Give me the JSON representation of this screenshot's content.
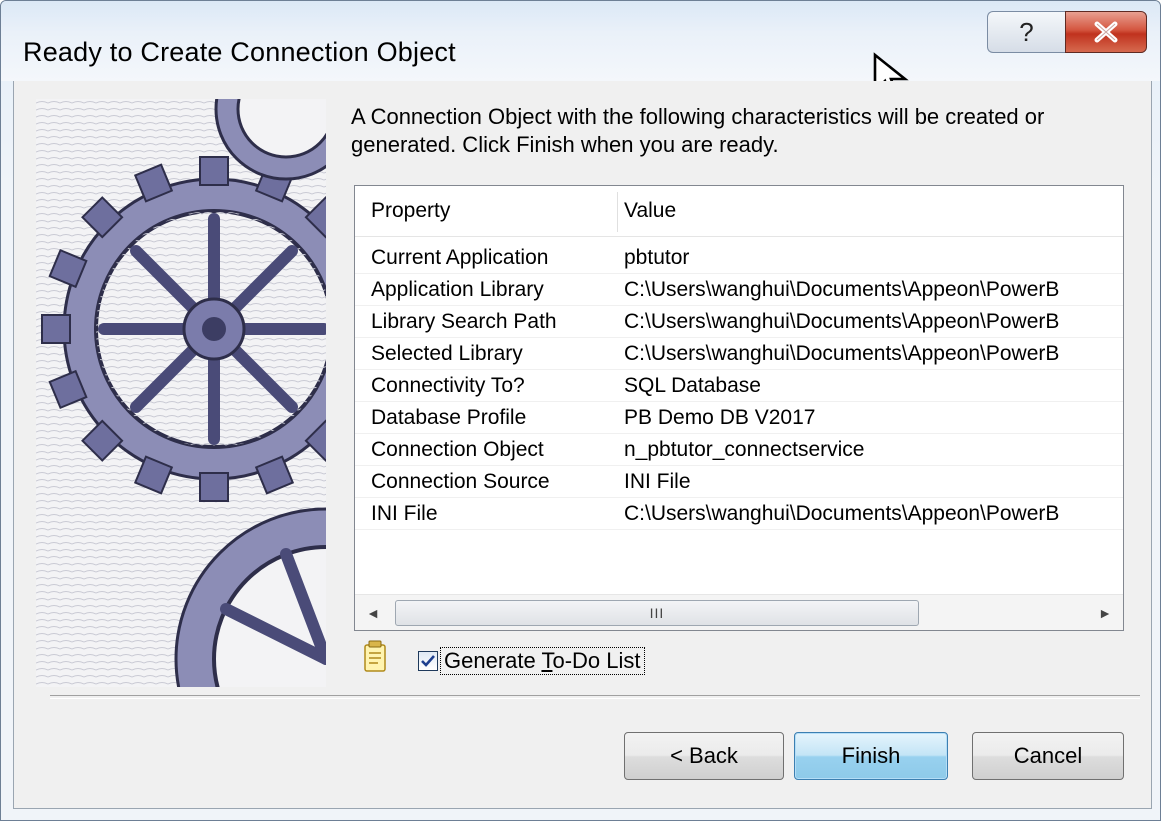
{
  "window": {
    "title": "Ready to Create Connection Object",
    "help_glyph": "?",
    "close_icon": "close-icon"
  },
  "intro": "A Connection Object with the following characteristics will be created or generated.  Click Finish when you are ready.",
  "table": {
    "headers": [
      "Property",
      "Value"
    ],
    "rows": [
      [
        "Current Application",
        "pbtutor"
      ],
      [
        "Application Library",
        "C:\\Users\\wanghui\\Documents\\Appeon\\PowerB"
      ],
      [
        "Library Search Path",
        "C:\\Users\\wanghui\\Documents\\Appeon\\PowerB"
      ],
      [
        "Selected Library",
        "C:\\Users\\wanghui\\Documents\\Appeon\\PowerB"
      ],
      [
        "Connectivity To?",
        "SQL Database"
      ],
      [
        "Database Profile",
        "PB Demo DB V2017"
      ],
      [
        "Connection Object",
        "n_pbtutor_connectservice"
      ],
      [
        "Connection Source",
        "INI File"
      ],
      [
        "INI File",
        "C:\\Users\\wanghui\\Documents\\Appeon\\PowerB"
      ]
    ],
    "scroll_left": "◄",
    "scroll_right": "►",
    "scroll_thumb_grip": "III"
  },
  "todo": {
    "checked": true,
    "label_prefix": "Generate ",
    "label_accel": "T",
    "label_suffix": "o-Do List"
  },
  "buttons": {
    "back": "< Back",
    "finish": "Finish",
    "cancel": "Cancel"
  },
  "colors": {
    "close_button": "#c0321e",
    "default_button": "#8ecae9",
    "gear": "#6e6f9e"
  }
}
